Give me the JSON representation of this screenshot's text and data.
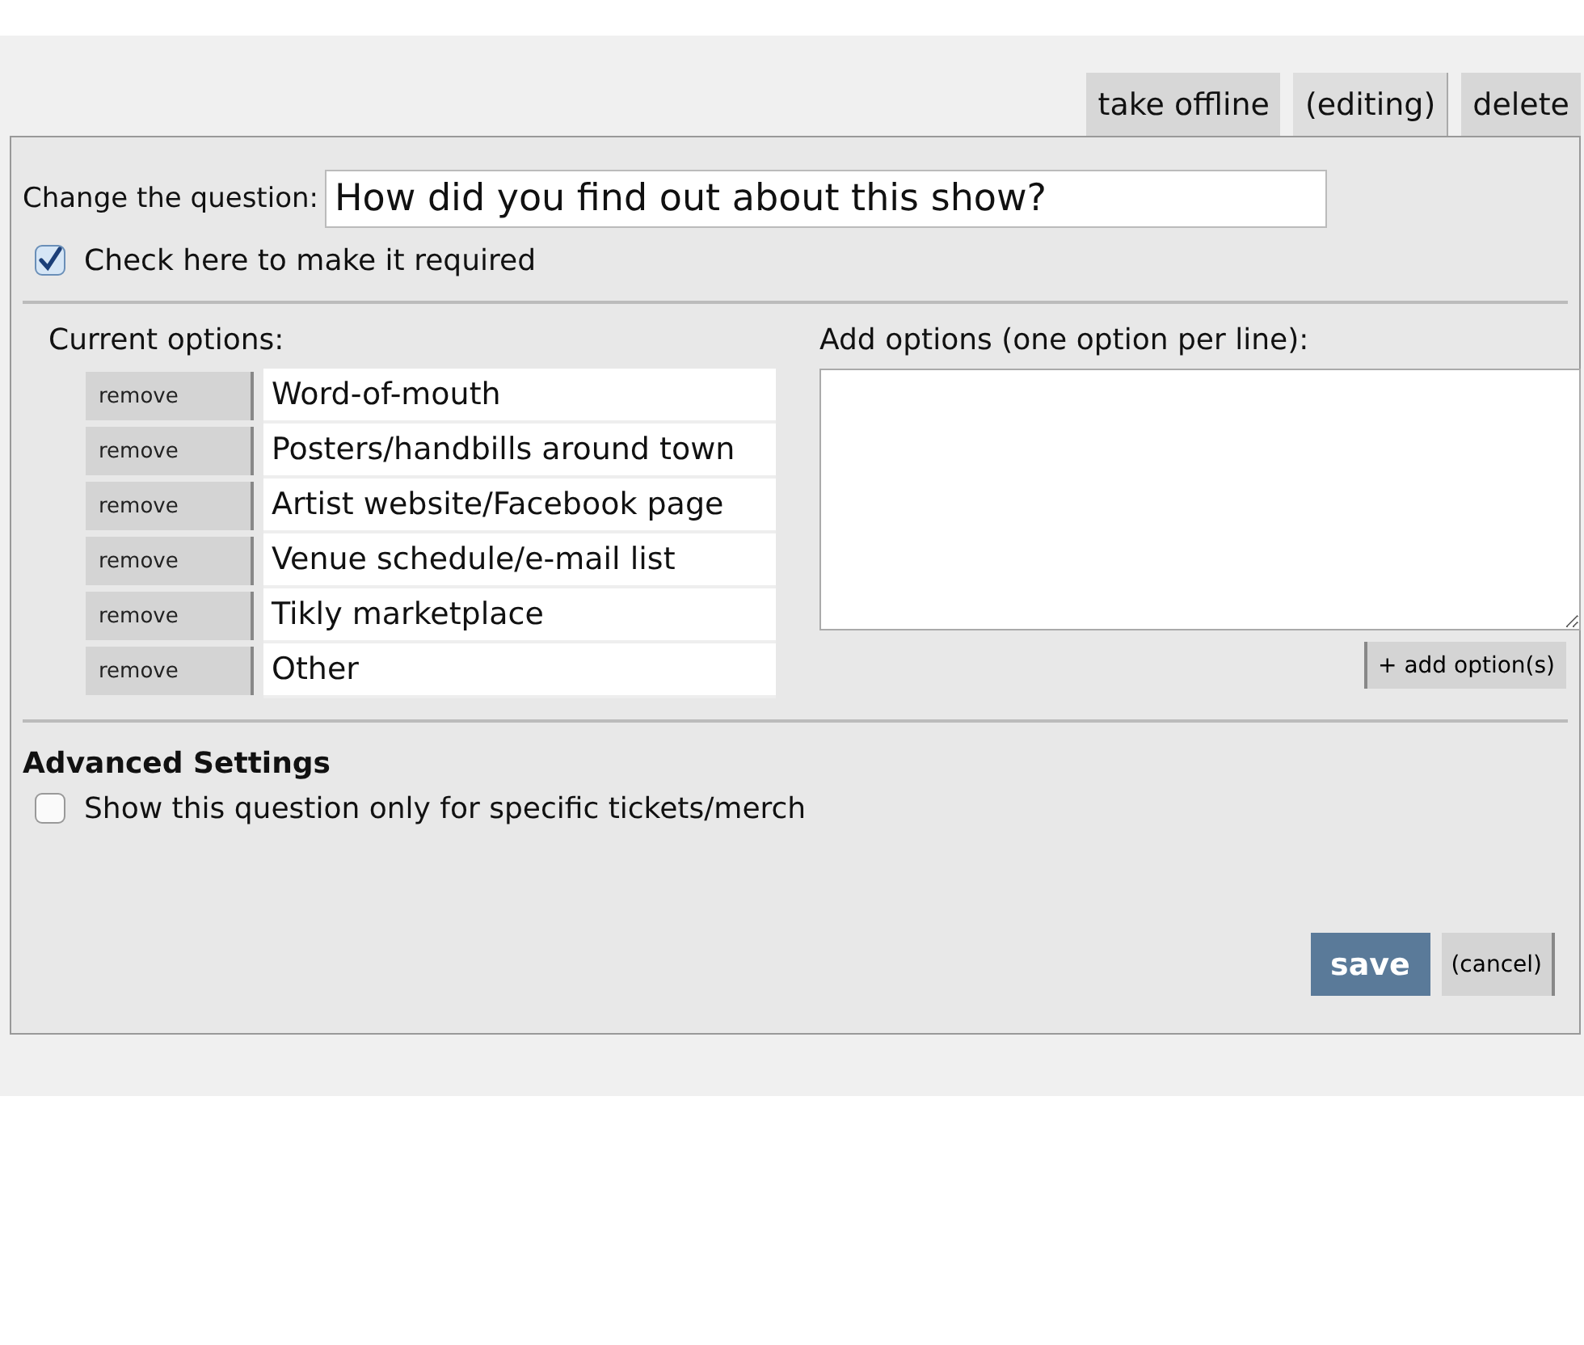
{
  "tabs": [
    {
      "label": "take offline",
      "selected": false
    },
    {
      "label": "(editing)",
      "selected": true
    },
    {
      "label": "delete",
      "selected": false
    }
  ],
  "question": {
    "label": "Change the question:",
    "value": "How did you find out about this show?"
  },
  "required": {
    "label": "Check here to make it required",
    "checked": true
  },
  "current_options": {
    "heading": "Current options:",
    "items": [
      {
        "remove": "remove",
        "text": "Word-of-mouth"
      },
      {
        "remove": "remove",
        "text": "Posters/handbills around town"
      },
      {
        "remove": "remove",
        "text": "Artist website/Facebook page"
      },
      {
        "remove": "remove",
        "text": "Venue schedule/e-mail list"
      },
      {
        "remove": "remove",
        "text": "Tikly marketplace"
      },
      {
        "remove": "remove",
        "text": "Other"
      }
    ]
  },
  "add_options": {
    "label": "Add options (one option per line):",
    "button": "+ add option(s)"
  },
  "advanced": {
    "heading": "Advanced Settings",
    "specific": {
      "label": "Show this question only for specific tickets/merch",
      "checked": false
    }
  },
  "actions": {
    "save": "save",
    "cancel": "(cancel)"
  }
}
